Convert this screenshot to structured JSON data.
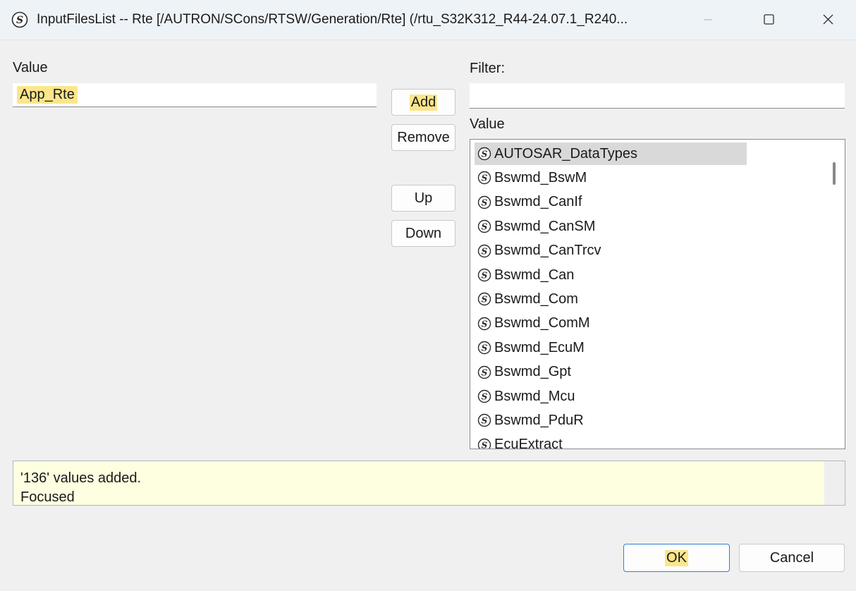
{
  "window": {
    "title": "InputFilesList -- Rte [/AUTRON/SCons/RTSW/Generation/Rte] (/rtu_S32K312_R44-24.07.1_R240...",
    "icon": "sirius-s-icon"
  },
  "left": {
    "value_label": "Value",
    "value_input": "App_Rte"
  },
  "buttons": {
    "add": "Add",
    "remove": "Remove",
    "up": "Up",
    "down": "Down",
    "ok": "OK",
    "cancel": "Cancel"
  },
  "right": {
    "filter_label": "Filter:",
    "filter_value": "",
    "list_label": "Value",
    "items": [
      "AUTOSAR_DataTypes",
      "Bswmd_BswM",
      "Bswmd_CanIf",
      "Bswmd_CanSM",
      "Bswmd_CanTrcv",
      "Bswmd_Can",
      "Bswmd_Com",
      "Bswmd_ComM",
      "Bswmd_EcuM",
      "Bswmd_Gpt",
      "Bswmd_Mcu",
      "Bswmd_PduR",
      "EcuExtract"
    ],
    "selected_index": 0
  },
  "status": {
    "lines": [
      "'136' values added.",
      "Focused"
    ]
  },
  "colors": {
    "highlight": "#fbe68b",
    "selection": "#d9d9d9",
    "status_bg": "#fefee0"
  }
}
